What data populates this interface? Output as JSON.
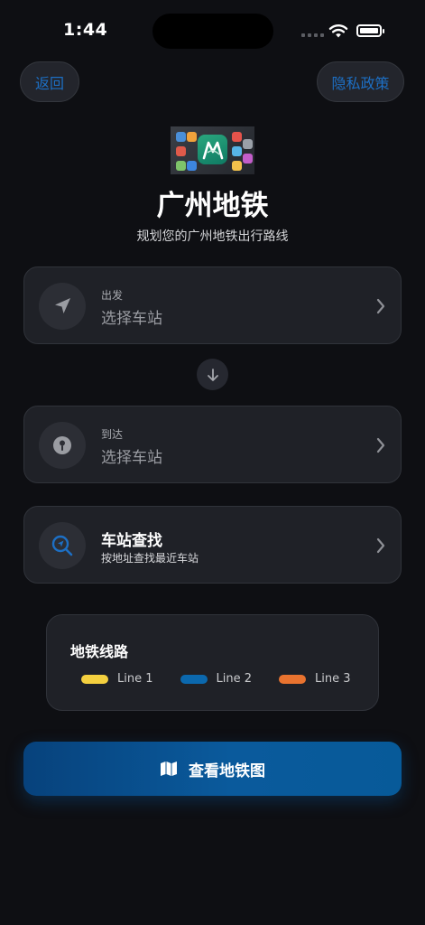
{
  "status_bar": {
    "time": "1:44"
  },
  "top_buttons": {
    "back": "返回",
    "privacy": "隐私政策"
  },
  "header": {
    "title": "广州地铁",
    "subtitle": "规划您的广州地铁出行路线"
  },
  "departure": {
    "label": "出发",
    "placeholder": "选择车站"
  },
  "arrival": {
    "label": "到达",
    "placeholder": "选择车站"
  },
  "station_search": {
    "title": "车站查找",
    "description": "按地址查找最近车站"
  },
  "lines": {
    "title": "地铁线路",
    "items": [
      {
        "name": "Line 1",
        "color": "#f4d03f"
      },
      {
        "name": "Line 2",
        "color": "#0b68ad"
      },
      {
        "name": "Line 3",
        "color": "#e9732f"
      }
    ]
  },
  "map_button": {
    "label": "查看地铁图"
  },
  "colors": {
    "accent": "#1d6fc4",
    "background": "#0e0f13",
    "card": "#1f2127"
  }
}
